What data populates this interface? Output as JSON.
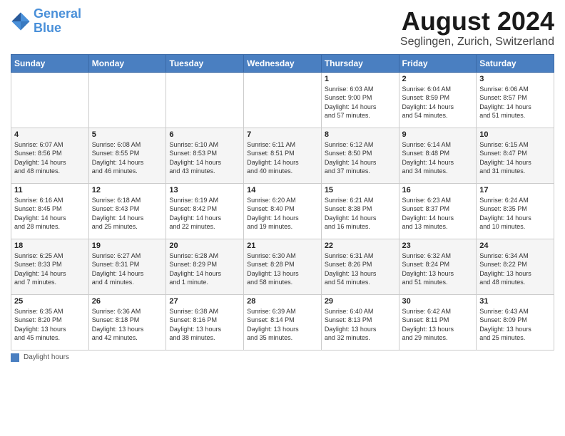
{
  "logo": {
    "line1": "General",
    "line2": "Blue"
  },
  "title": "August 2024",
  "location": "Seglingen, Zurich, Switzerland",
  "days_of_week": [
    "Sunday",
    "Monday",
    "Tuesday",
    "Wednesday",
    "Thursday",
    "Friday",
    "Saturday"
  ],
  "footer": {
    "label": "Daylight hours"
  },
  "weeks": [
    [
      {
        "day": "",
        "info": ""
      },
      {
        "day": "",
        "info": ""
      },
      {
        "day": "",
        "info": ""
      },
      {
        "day": "",
        "info": ""
      },
      {
        "day": "1",
        "info": "Sunrise: 6:03 AM\nSunset: 9:00 PM\nDaylight: 14 hours\nand 57 minutes."
      },
      {
        "day": "2",
        "info": "Sunrise: 6:04 AM\nSunset: 8:59 PM\nDaylight: 14 hours\nand 54 minutes."
      },
      {
        "day": "3",
        "info": "Sunrise: 6:06 AM\nSunset: 8:57 PM\nDaylight: 14 hours\nand 51 minutes."
      }
    ],
    [
      {
        "day": "4",
        "info": "Sunrise: 6:07 AM\nSunset: 8:56 PM\nDaylight: 14 hours\nand 48 minutes."
      },
      {
        "day": "5",
        "info": "Sunrise: 6:08 AM\nSunset: 8:55 PM\nDaylight: 14 hours\nand 46 minutes."
      },
      {
        "day": "6",
        "info": "Sunrise: 6:10 AM\nSunset: 8:53 PM\nDaylight: 14 hours\nand 43 minutes."
      },
      {
        "day": "7",
        "info": "Sunrise: 6:11 AM\nSunset: 8:51 PM\nDaylight: 14 hours\nand 40 minutes."
      },
      {
        "day": "8",
        "info": "Sunrise: 6:12 AM\nSunset: 8:50 PM\nDaylight: 14 hours\nand 37 minutes."
      },
      {
        "day": "9",
        "info": "Sunrise: 6:14 AM\nSunset: 8:48 PM\nDaylight: 14 hours\nand 34 minutes."
      },
      {
        "day": "10",
        "info": "Sunrise: 6:15 AM\nSunset: 8:47 PM\nDaylight: 14 hours\nand 31 minutes."
      }
    ],
    [
      {
        "day": "11",
        "info": "Sunrise: 6:16 AM\nSunset: 8:45 PM\nDaylight: 14 hours\nand 28 minutes."
      },
      {
        "day": "12",
        "info": "Sunrise: 6:18 AM\nSunset: 8:43 PM\nDaylight: 14 hours\nand 25 minutes."
      },
      {
        "day": "13",
        "info": "Sunrise: 6:19 AM\nSunset: 8:42 PM\nDaylight: 14 hours\nand 22 minutes."
      },
      {
        "day": "14",
        "info": "Sunrise: 6:20 AM\nSunset: 8:40 PM\nDaylight: 14 hours\nand 19 minutes."
      },
      {
        "day": "15",
        "info": "Sunrise: 6:21 AM\nSunset: 8:38 PM\nDaylight: 14 hours\nand 16 minutes."
      },
      {
        "day": "16",
        "info": "Sunrise: 6:23 AM\nSunset: 8:37 PM\nDaylight: 14 hours\nand 13 minutes."
      },
      {
        "day": "17",
        "info": "Sunrise: 6:24 AM\nSunset: 8:35 PM\nDaylight: 14 hours\nand 10 minutes."
      }
    ],
    [
      {
        "day": "18",
        "info": "Sunrise: 6:25 AM\nSunset: 8:33 PM\nDaylight: 14 hours\nand 7 minutes."
      },
      {
        "day": "19",
        "info": "Sunrise: 6:27 AM\nSunset: 8:31 PM\nDaylight: 14 hours\nand 4 minutes."
      },
      {
        "day": "20",
        "info": "Sunrise: 6:28 AM\nSunset: 8:29 PM\nDaylight: 14 hours\nand 1 minute."
      },
      {
        "day": "21",
        "info": "Sunrise: 6:30 AM\nSunset: 8:28 PM\nDaylight: 13 hours\nand 58 minutes."
      },
      {
        "day": "22",
        "info": "Sunrise: 6:31 AM\nSunset: 8:26 PM\nDaylight: 13 hours\nand 54 minutes."
      },
      {
        "day": "23",
        "info": "Sunrise: 6:32 AM\nSunset: 8:24 PM\nDaylight: 13 hours\nand 51 minutes."
      },
      {
        "day": "24",
        "info": "Sunrise: 6:34 AM\nSunset: 8:22 PM\nDaylight: 13 hours\nand 48 minutes."
      }
    ],
    [
      {
        "day": "25",
        "info": "Sunrise: 6:35 AM\nSunset: 8:20 PM\nDaylight: 13 hours\nand 45 minutes."
      },
      {
        "day": "26",
        "info": "Sunrise: 6:36 AM\nSunset: 8:18 PM\nDaylight: 13 hours\nand 42 minutes."
      },
      {
        "day": "27",
        "info": "Sunrise: 6:38 AM\nSunset: 8:16 PM\nDaylight: 13 hours\nand 38 minutes."
      },
      {
        "day": "28",
        "info": "Sunrise: 6:39 AM\nSunset: 8:14 PM\nDaylight: 13 hours\nand 35 minutes."
      },
      {
        "day": "29",
        "info": "Sunrise: 6:40 AM\nSunset: 8:13 PM\nDaylight: 13 hours\nand 32 minutes."
      },
      {
        "day": "30",
        "info": "Sunrise: 6:42 AM\nSunset: 8:11 PM\nDaylight: 13 hours\nand 29 minutes."
      },
      {
        "day": "31",
        "info": "Sunrise: 6:43 AM\nSunset: 8:09 PM\nDaylight: 13 hours\nand 25 minutes."
      }
    ]
  ]
}
